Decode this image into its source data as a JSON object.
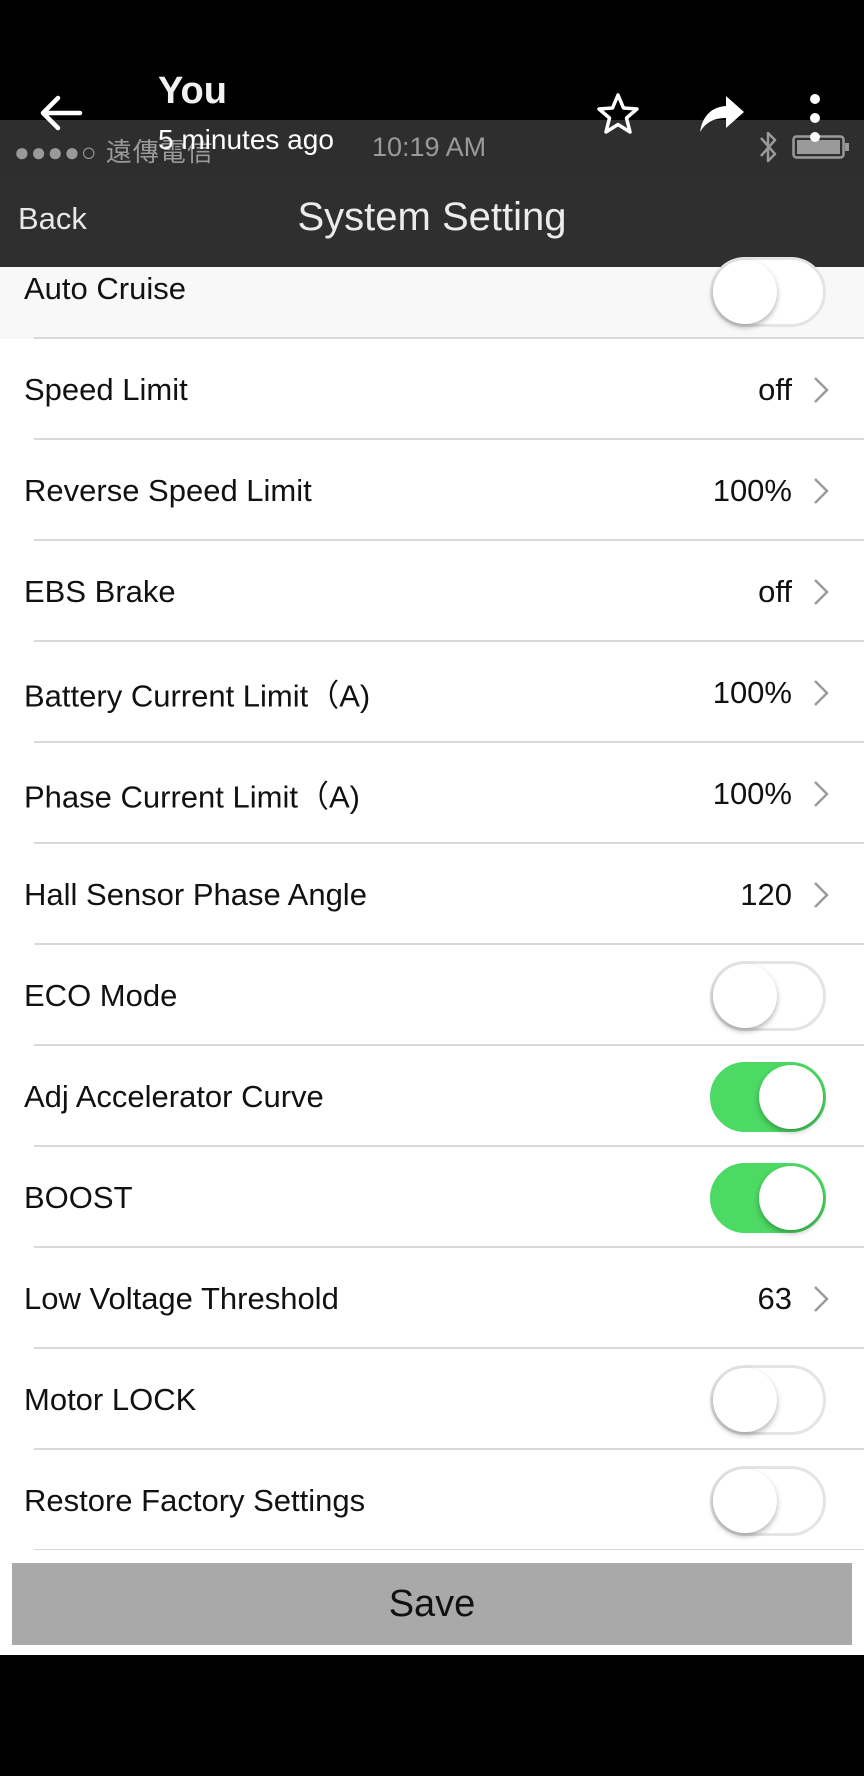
{
  "viewer": {
    "title": "You",
    "subtitle": "5 minutes ago"
  },
  "status_bar": {
    "carrier": "●●●●○ 遠傳電信",
    "time": "10:19 AM"
  },
  "navbar": {
    "back_label": "Back",
    "title": "System Setting"
  },
  "settings": [
    {
      "label": "Auto Cruise",
      "type": "toggle",
      "on": false
    },
    {
      "label": "Speed Limit",
      "type": "value",
      "value": "off"
    },
    {
      "label": "Reverse Speed Limit",
      "type": "value",
      "value": "100%"
    },
    {
      "label": "EBS Brake",
      "type": "value",
      "value": "off"
    },
    {
      "label": "Battery Current Limit（A)",
      "type": "value",
      "value": "100%"
    },
    {
      "label": "Phase Current Limit（A)",
      "type": "value",
      "value": "100%"
    },
    {
      "label": "Hall Sensor Phase Angle",
      "type": "value",
      "value": "120"
    },
    {
      "label": "ECO Mode",
      "type": "toggle",
      "on": false
    },
    {
      "label": "Adj Accelerator Curve",
      "type": "toggle",
      "on": true
    },
    {
      "label": "BOOST",
      "type": "toggle",
      "on": true
    },
    {
      "label": "Low Voltage Threshold",
      "type": "value",
      "value": "63"
    },
    {
      "label": "Motor LOCK",
      "type": "toggle",
      "on": false
    },
    {
      "label": "Restore Factory Settings",
      "type": "toggle",
      "on": false
    }
  ],
  "save_label": "Save",
  "colors": {
    "toggle_on": "#4cd964",
    "navbar_bg": "#2f2f2f",
    "save_button_bg": "#a9a9a9"
  },
  "icons": [
    "back-arrow-icon",
    "star-icon",
    "share-icon",
    "more-vert-icon",
    "bluetooth-icon",
    "battery-icon",
    "chevron-right-icon"
  ]
}
